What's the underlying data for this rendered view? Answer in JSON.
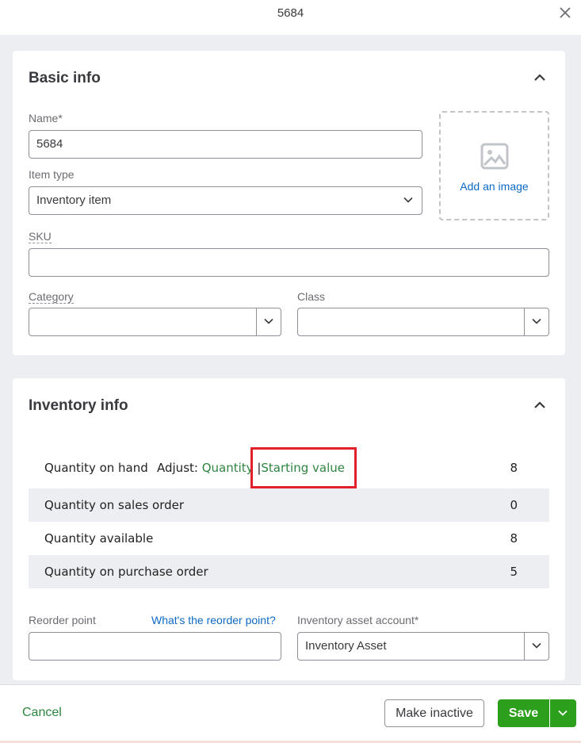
{
  "window": {
    "title": "5684"
  },
  "basic_info": {
    "title": "Basic info",
    "name_label": "Name*",
    "name_value": "5684",
    "item_type_label": "Item type",
    "item_type_value": "Inventory item",
    "add_image_label": "Add an image",
    "sku_label": "SKU",
    "sku_value": "",
    "category_label": "Category",
    "category_value": "",
    "class_label": "Class",
    "class_value": ""
  },
  "inventory_info": {
    "title": "Inventory info",
    "adjust_label": "Adjust:",
    "adjust_quantity": "Quantity",
    "adjust_separator": "|",
    "adjust_starting_value": "Starting value",
    "rows": [
      {
        "name": "Quantity on hand",
        "value": "8"
      },
      {
        "name": "Quantity on sales order",
        "value": "0"
      },
      {
        "name": "Quantity available",
        "value": "8"
      },
      {
        "name": "Quantity on purchase order",
        "value": "5"
      }
    ],
    "reorder_point_label": "Reorder point",
    "reorder_help_link": "What's the reorder point?",
    "reorder_point_value": "",
    "asset_account_label": "Inventory asset account*",
    "asset_account_value": "Inventory Asset"
  },
  "footer": {
    "cancel_label": "Cancel",
    "make_inactive_label": "Make inactive",
    "save_label": "Save"
  },
  "colors": {
    "accent_green": "#2ca01c",
    "link_green": "#2e8540",
    "link_blue": "#0d6ac5",
    "highlight_red": "#e0202a"
  }
}
